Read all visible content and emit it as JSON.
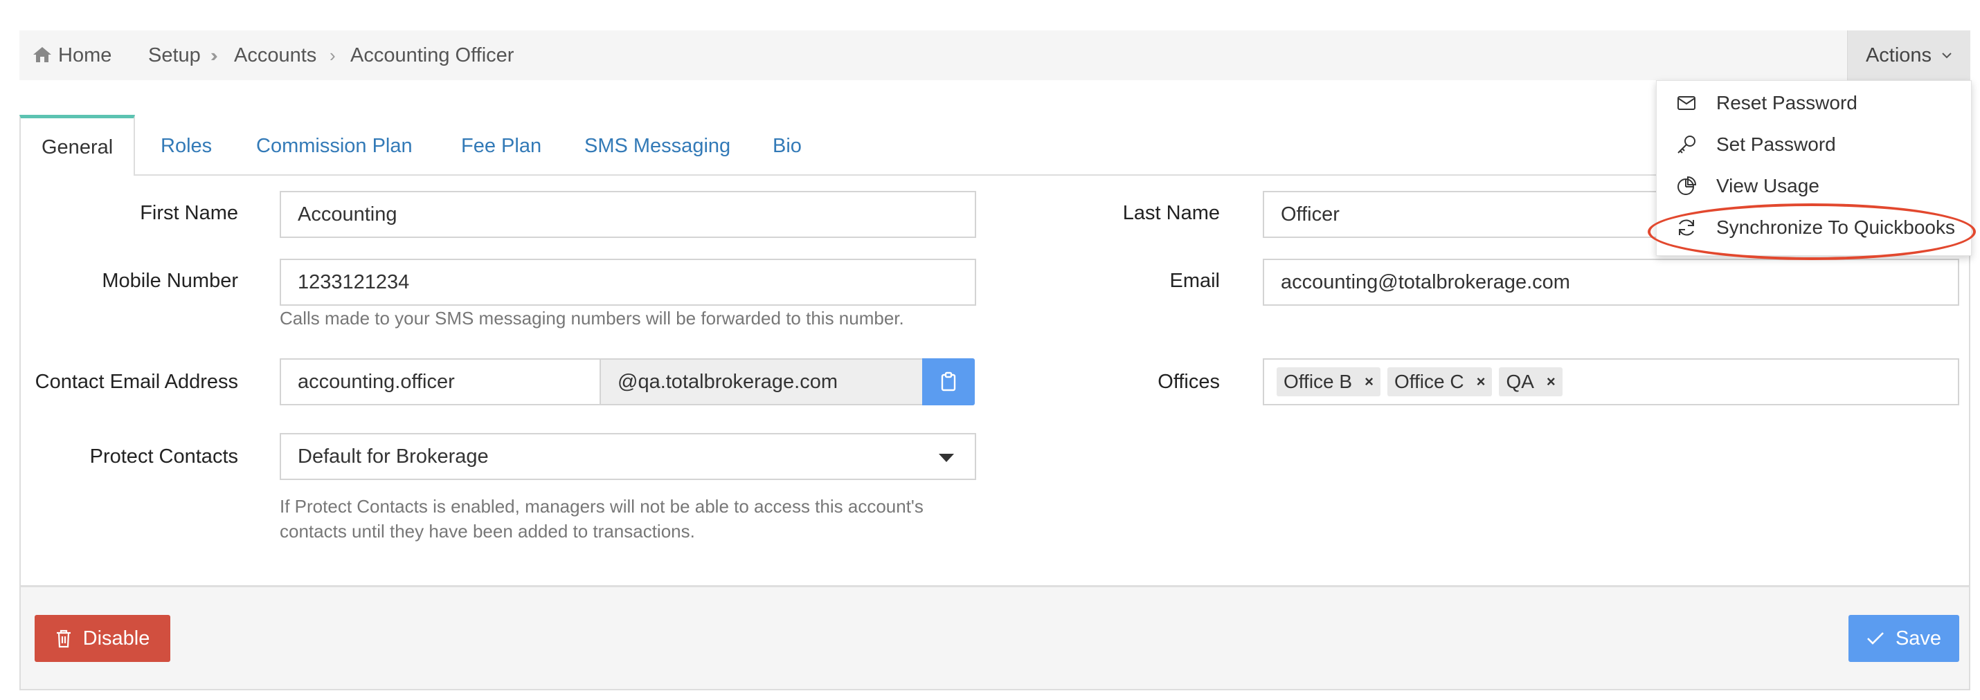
{
  "breadcrumb": {
    "items": [
      "Home",
      "Setup",
      "Accounts",
      "Accounting Officer"
    ],
    "actions_label": "Actions"
  },
  "actions_menu": {
    "items": [
      "Reset Password",
      "Set Password",
      "View Usage",
      "Synchronize To Quickbooks"
    ]
  },
  "tabs": [
    "General",
    "Roles",
    "Commission Plan",
    "Fee Plan",
    "SMS Messaging",
    "Bio"
  ],
  "form": {
    "first_name": {
      "label": "First Name",
      "value": "Accounting"
    },
    "last_name": {
      "label": "Last Name",
      "value": "Officer"
    },
    "mobile": {
      "label": "Mobile Number",
      "value": "1233121234",
      "help": "Calls made to your SMS messaging numbers will be forwarded to this number."
    },
    "email": {
      "label": "Email",
      "value": "accounting@totalbrokerage.com"
    },
    "contact_email": {
      "label": "Contact Email Address",
      "value": "accounting.officer",
      "domain": "@qa.totalbrokerage.com"
    },
    "offices": {
      "label": "Offices",
      "tags": [
        "Office B",
        "Office C",
        "QA"
      ]
    },
    "protect_contacts": {
      "label": "Protect Contacts",
      "value": "Default for Brokerage",
      "help_line1": "If Protect Contacts is enabled, managers will not be able to access this account's",
      "help_line2": "contacts until they have been added to transactions."
    }
  },
  "footer": {
    "disable_label": "Disable",
    "save_label": "Save"
  },
  "colors": {
    "accent_tab": "#5cc3b1",
    "link": "#337ab7",
    "danger": "#d14f3f",
    "primary": "#5b9cf0",
    "highlight": "#e2482e"
  }
}
